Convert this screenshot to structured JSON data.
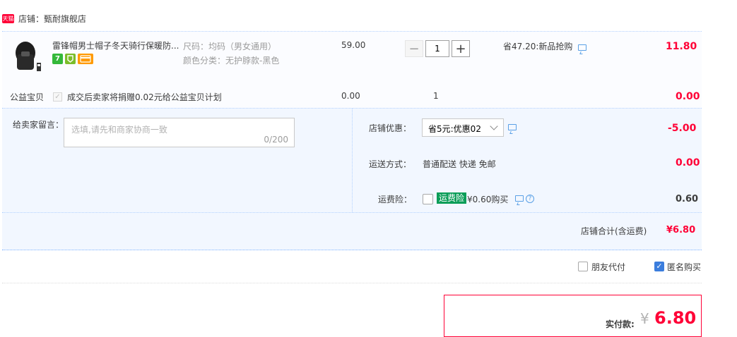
{
  "store": {
    "badge": "天猫",
    "label": "店铺：甄耐旗舰店"
  },
  "item": {
    "title": "雷锋帽男士帽子冬天骑行保暖防...",
    "badges": [
      "7",
      "",
      ""
    ],
    "spec_size": "尺码：均码（男女通用）",
    "spec_color": "颜色分类：无护脖款-黑色",
    "unit_price": "59.00",
    "quantity": "1",
    "minus": "−",
    "plus": "+",
    "promo": "省47.20:新品抢购",
    "subtotal": "11.80"
  },
  "charity": {
    "label": "公益宝贝",
    "check": "✓",
    "text": "成交后卖家将捐赠0.02元给公益宝贝计划",
    "price": "0.00",
    "qty": "1",
    "subtotal": "0.00"
  },
  "message": {
    "label": "给卖家留言：",
    "placeholder": "选填,请先和商家协商一致",
    "counter": "0/200"
  },
  "discount": {
    "label": "店铺优惠：",
    "selected": "省5元:优惠02",
    "value": "-5.00"
  },
  "shipping": {
    "label": "运送方式：",
    "value_text": "普通配送 快递 免邮",
    "value": "0.00"
  },
  "insurance": {
    "label": "运费险：",
    "badge": "运费险",
    "text": "¥0.60购买",
    "help": "?",
    "value": "0.60"
  },
  "total": {
    "label": "店铺合计(含运费)",
    "value": "¥6.80"
  },
  "options": {
    "friend_pay": "朋友代付",
    "anonymous": "匿名购买",
    "anonymous_check": "✓"
  },
  "payment": {
    "label": "实付款:",
    "currency": "¥",
    "amount": "6.80"
  },
  "colors": {
    "accent_red": "#ff0036",
    "border_blue": "#b2d1ff",
    "bg_blue": "#f2f7ff"
  }
}
